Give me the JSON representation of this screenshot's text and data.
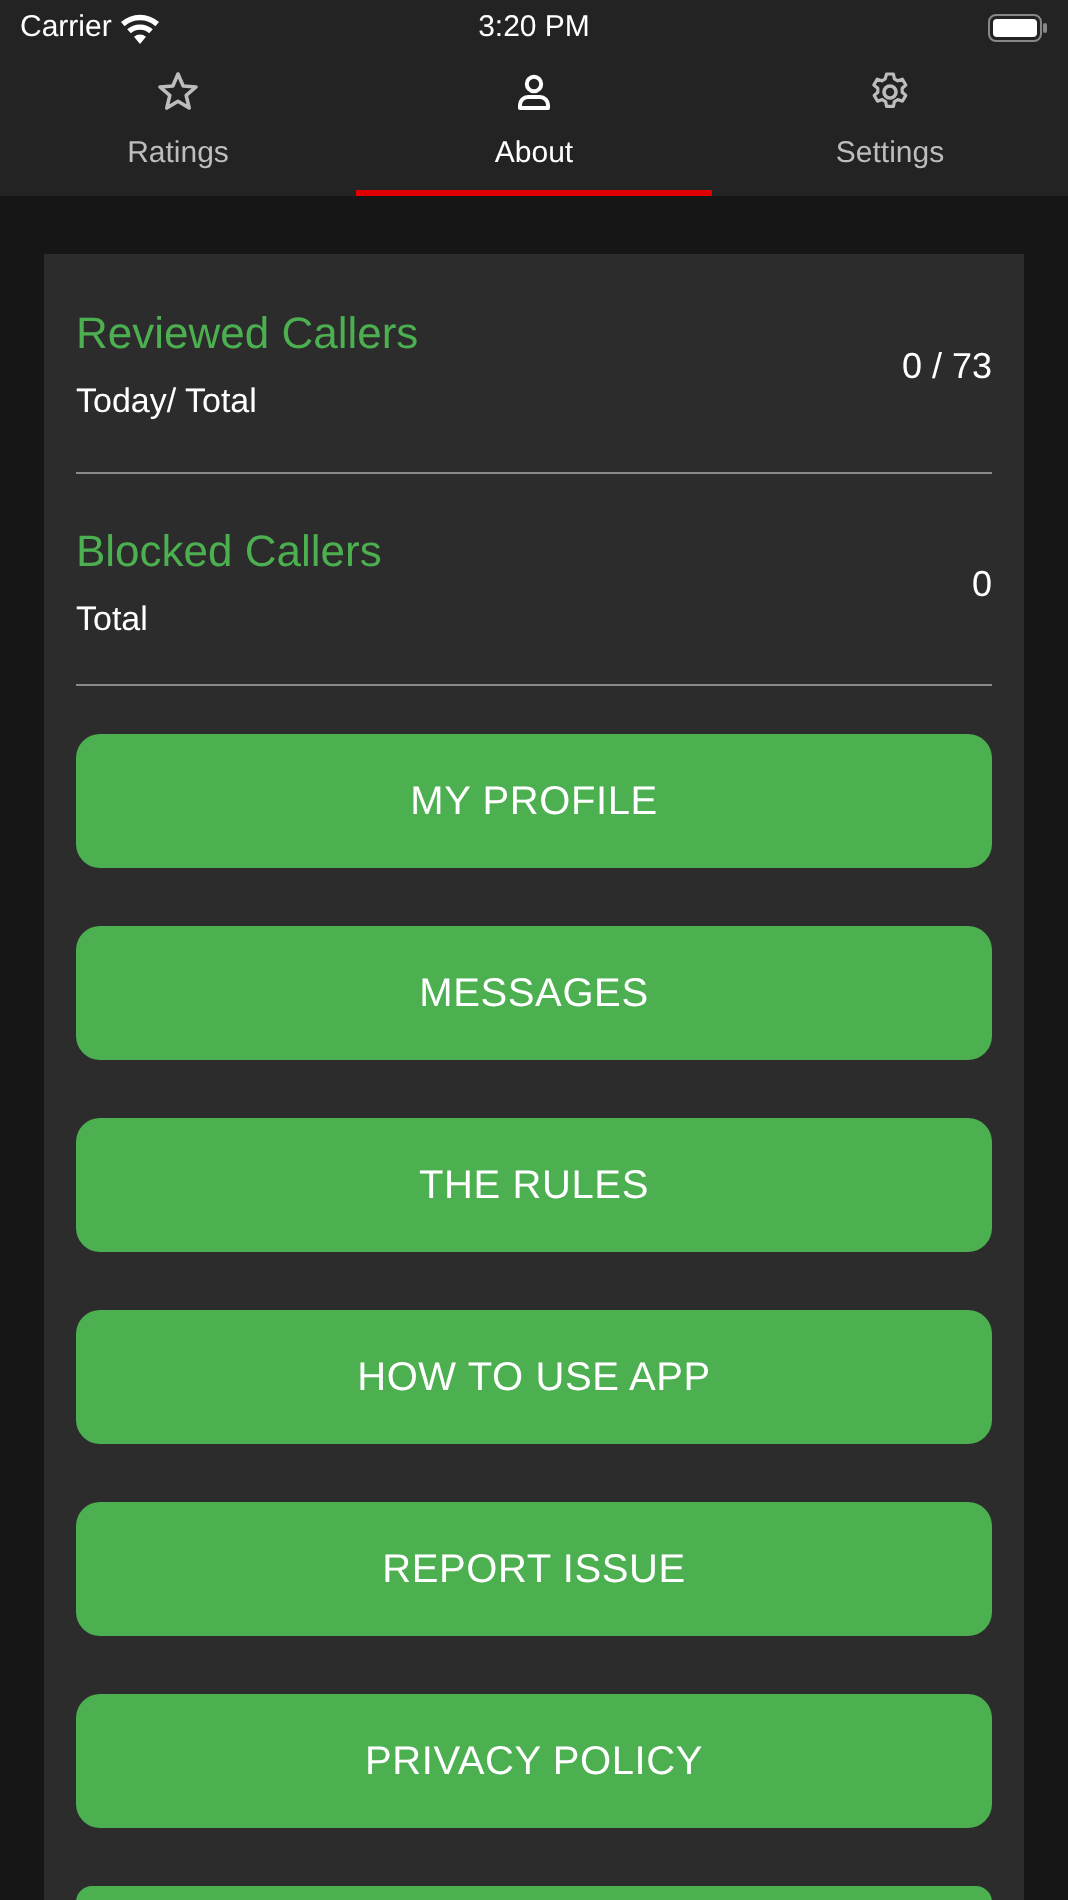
{
  "status_bar": {
    "carrier": "Carrier",
    "time": "3:20 PM"
  },
  "tabs": [
    {
      "label": "Ratings",
      "kind": "star",
      "selected": false
    },
    {
      "label": "About",
      "kind": "person",
      "selected": true
    },
    {
      "label": "Settings",
      "kind": "gear",
      "selected": false
    }
  ],
  "stats": [
    {
      "title": "Reviewed Callers",
      "subtitle": "Today/ Total",
      "value": "0 / 73"
    },
    {
      "title": "Blocked Callers",
      "subtitle": "Total",
      "value": "0"
    }
  ],
  "buttons": [
    {
      "label": "MY PROFILE"
    },
    {
      "label": "MESSAGES"
    },
    {
      "label": "THE RULES"
    },
    {
      "label": "HOW TO USE APP"
    },
    {
      "label": "REPORT ISSUE"
    },
    {
      "label": "PRIVACY POLICY"
    },
    {
      "kind": "cut"
    }
  ]
}
